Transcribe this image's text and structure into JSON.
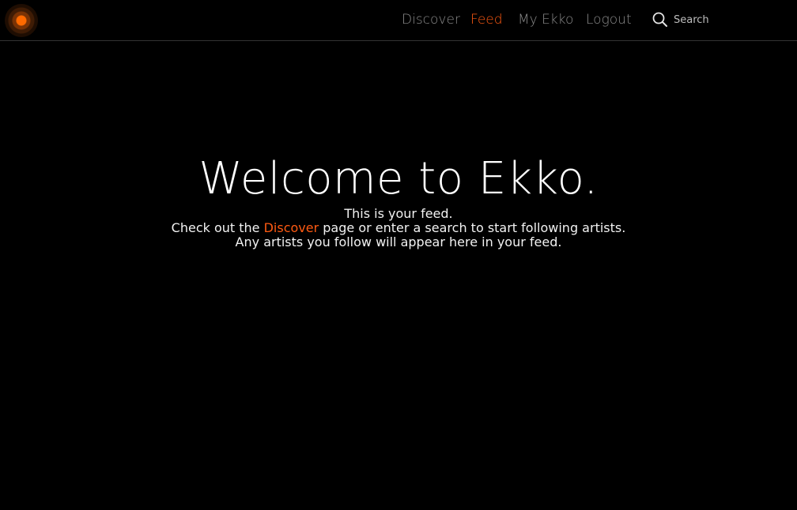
{
  "nav": {
    "discover_label": "Discover",
    "feed_label": "Feed",
    "myekko_label": "My Ekko",
    "logout_label": "Logout",
    "active": "Feed"
  },
  "search": {
    "placeholder": "Search",
    "value": ""
  },
  "welcome": {
    "title": "Welcome to Ekko.",
    "line1": "This is your feed.",
    "line2_prefix": "Check out the ",
    "line2_link": "Discover",
    "line2_suffix": " page or enter a search to start following artists.",
    "line3": "Any artists you follow will appear here in your feed."
  },
  "colors": {
    "accent": "#ff5a12",
    "background": "#000000",
    "nav_text": "#8c8c8c"
  },
  "icons": {
    "logo": "ekko-logo-icon",
    "search": "search-icon"
  }
}
